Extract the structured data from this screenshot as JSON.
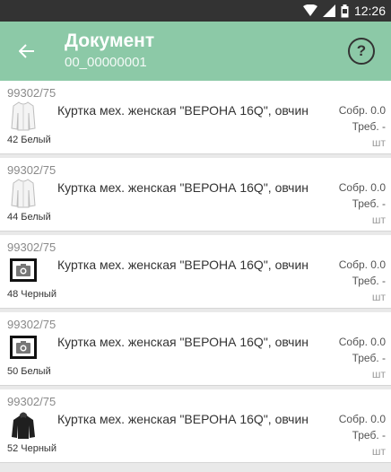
{
  "status_bar": {
    "time": "12:26",
    "icons": [
      "wifi-icon",
      "signal-icon",
      "battery-icon"
    ]
  },
  "header": {
    "title": "Документ",
    "subtitle": "00_00000001",
    "back_icon": "arrow-left-icon",
    "help_label": "?"
  },
  "colors": {
    "accent": "#8cc9a7",
    "status_bar": "#333333",
    "background": "#e9e9e9"
  },
  "items": [
    {
      "code": "99302/75",
      "name": "Куртка мех. женская \"ВЕРОНА 16Q\", овчин",
      "size_color": "42 Белый",
      "collected": "Собр. 0.0",
      "required": "Треб. -",
      "unit": "шт",
      "thumb": "white-jacket"
    },
    {
      "code": "99302/75",
      "name": "Куртка мех. женская \"ВЕРОНА 16Q\", овчин",
      "size_color": "44 Белый",
      "collected": "Собр. 0.0",
      "required": "Треб. -",
      "unit": "шт",
      "thumb": "white-jacket"
    },
    {
      "code": "99302/75",
      "name": "Куртка мех. женская \"ВЕРОНА 16Q\", овчин",
      "size_color": "48 Черный",
      "collected": "Собр. 0.0",
      "required": "Треб. -",
      "unit": "шт",
      "thumb": "camera-placeholder"
    },
    {
      "code": "99302/75",
      "name": "Куртка мех. женская \"ВЕРОНА 16Q\", овчин",
      "size_color": "50 Белый",
      "collected": "Собр. 0.0",
      "required": "Треб. -",
      "unit": "шт",
      "thumb": "camera-placeholder"
    },
    {
      "code": "99302/75",
      "name": "Куртка мех. женская \"ВЕРОНА 16Q\", овчин",
      "size_color": "52 Черный",
      "collected": "Собр. 0.0",
      "required": "Треб. -",
      "unit": "шт",
      "thumb": "black-jacket"
    }
  ]
}
